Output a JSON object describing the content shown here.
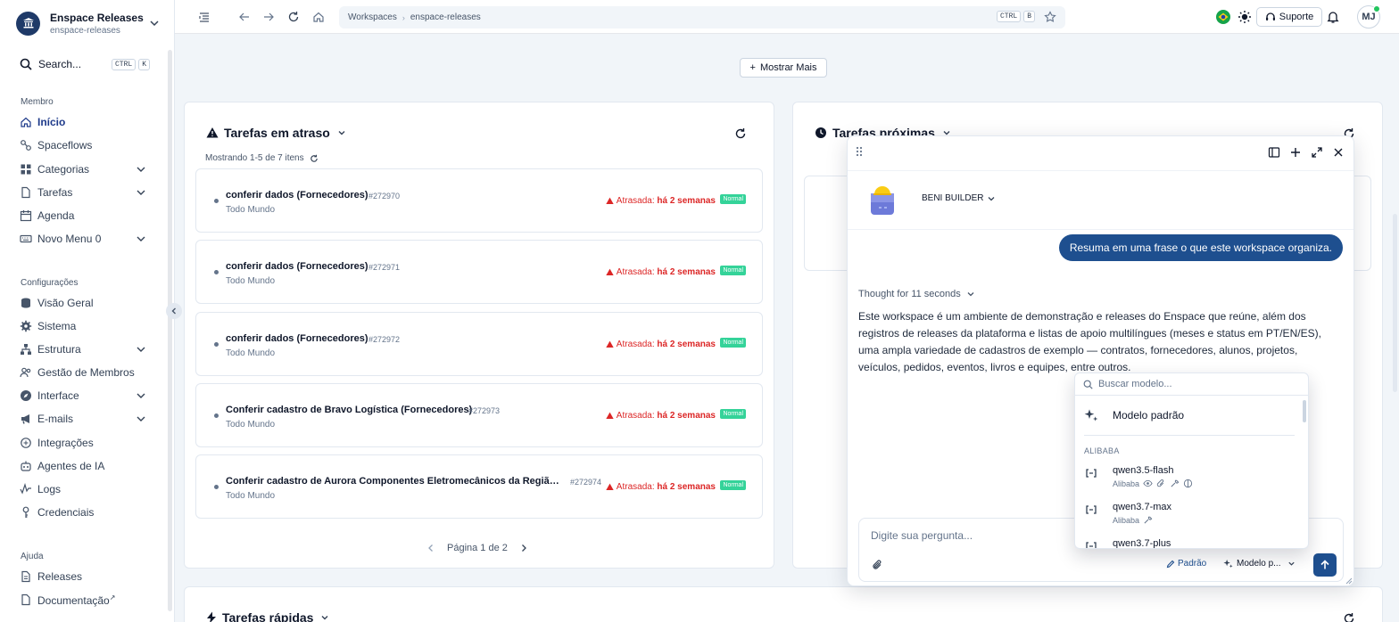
{
  "workspace": {
    "title": "Enspace Releases",
    "subtitle": "enspace-releases"
  },
  "search": {
    "label": "Search...",
    "keys": [
      "CTRL",
      "K"
    ]
  },
  "sidebar": {
    "sections": [
      {
        "title": "Membro",
        "items": [
          {
            "label": "Início",
            "icon": "home-icon",
            "active": true
          },
          {
            "label": "Spaceflows",
            "icon": "flow-icon"
          },
          {
            "label": "Categorias",
            "icon": "grid-icon",
            "expandable": true
          },
          {
            "label": "Tarefas",
            "icon": "file-icon",
            "expandable": true
          },
          {
            "label": "Agenda",
            "icon": "calendar-icon"
          },
          {
            "label": "Novo Menu 0",
            "icon": "keyboard-icon",
            "expandable": true
          }
        ]
      },
      {
        "title": "Configurações",
        "items": [
          {
            "label": "Visão Geral",
            "icon": "stack-icon"
          },
          {
            "label": "Sistema",
            "icon": "gear-icon"
          },
          {
            "label": "Estrutura",
            "icon": "structure-icon",
            "expandable": true
          },
          {
            "label": "Gestão de Membros",
            "icon": "users-icon"
          },
          {
            "label": "Interface",
            "icon": "compass-icon",
            "expandable": true
          },
          {
            "label": "E-mails",
            "icon": "megaphone-icon",
            "expandable": true
          },
          {
            "label": "Integrações",
            "icon": "link-icon"
          },
          {
            "label": "Agentes de IA",
            "icon": "bot-icon"
          },
          {
            "label": "Logs",
            "icon": "logs-icon"
          },
          {
            "label": "Credenciais",
            "icon": "key-icon"
          }
        ]
      },
      {
        "title": "Ajuda",
        "items": [
          {
            "label": "Releases",
            "icon": "file-icon"
          },
          {
            "label": "Documentação",
            "icon": "doc-icon",
            "external": "↗"
          }
        ]
      }
    ]
  },
  "topbar": {
    "breadcrumb": [
      "Workspaces",
      "enspace-releases"
    ],
    "bookmark_keys": [
      "CTRL",
      "B"
    ],
    "support_label": "Suporte",
    "avatar_initials": "MJ"
  },
  "main": {
    "show_more": "Mostrar Mais",
    "overdue": {
      "title": "Tarefas em atraso",
      "showing": "Mostrando 1-5 de 7 itens",
      "tasks": [
        {
          "name": "conferir dados (Fornecedores)",
          "id": "#272970",
          "assignee": "Todo Mundo",
          "late_prefix": "Atrasada:",
          "late_when": "há 2 semanas",
          "priority": "Normal"
        },
        {
          "name": "conferir dados (Fornecedores)",
          "id": "#272971",
          "assignee": "Todo Mundo",
          "late_prefix": "Atrasada:",
          "late_when": "há 2 semanas",
          "priority": "Normal"
        },
        {
          "name": "conferir dados (Fornecedores)",
          "id": "#272972",
          "assignee": "Todo Mundo",
          "late_prefix": "Atrasada:",
          "late_when": "há 2 semanas",
          "priority": "Normal"
        },
        {
          "name": "Conferir cadastro de Bravo Logística (Fornecedores)",
          "id": "#272973",
          "assignee": "Todo Mundo",
          "late_prefix": "Atrasada:",
          "late_when": "há 2 semanas",
          "priority": "Normal"
        },
        {
          "name": "Conferir cadastro de Aurora Componentes Eletromecânicos da Região ...",
          "id": "#272974",
          "assignee": "Todo Mundo",
          "late_prefix": "Atrasada:",
          "late_when": "há 2 semanas",
          "priority": "Normal"
        }
      ],
      "page_label": "Página 1 de 2"
    },
    "upcoming": {
      "title": "Tarefas próximas"
    },
    "quick": {
      "title": "Tarefas rápidas"
    }
  },
  "chat": {
    "agent_name": "BENI BUILDER",
    "user_message": "Resuma em uma frase o que este workspace organiza.",
    "thought": "Thought for 11 seconds",
    "answer": "Este workspace é um ambiente de demonstração e releases do Enspace que reúne, além dos registros de releases da plataforma e listas de apoio multilíngues (meses e status em PT/EN/ES), uma ampla variedade de cadastros de exemplo — contratos, fornecedores, alunos, projetos, veículos, pedidos, eventos, livros e equipes, entre outros.",
    "input_placeholder": "Digite sua pergunta...",
    "mode_label": "Padrão",
    "model_label": "Modelo p..."
  },
  "model_dropdown": {
    "search_placeholder": "Buscar modelo...",
    "default_option": "Modelo padrão",
    "group": "ALIBABA",
    "models": [
      {
        "name": "qwen3.5-flash",
        "provider": "Alibaba",
        "capabilities": [
          "eye-icon",
          "paperclip-icon",
          "wrench-icon",
          "brain-icon"
        ]
      },
      {
        "name": "qwen3.7-max",
        "provider": "Alibaba",
        "capabilities": [
          "wrench-icon"
        ]
      },
      {
        "name": "qwen3.7-plus",
        "provider": "Alibaba",
        "capabilities": []
      }
    ]
  }
}
